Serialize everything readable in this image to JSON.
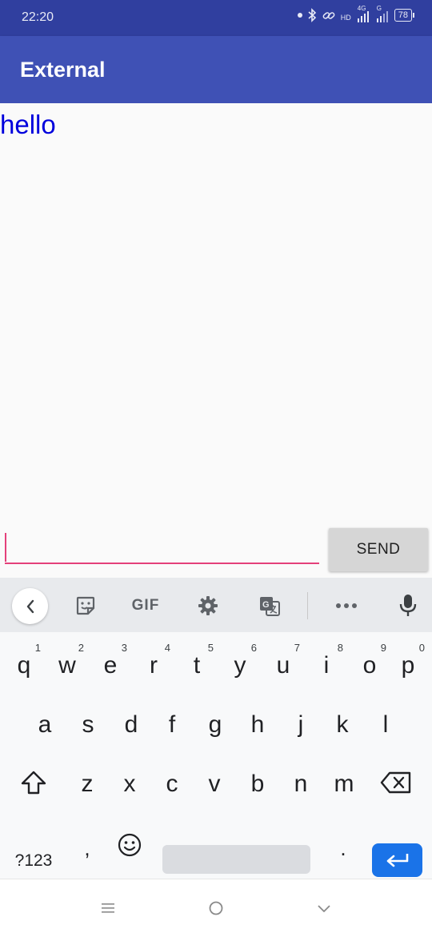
{
  "status_bar": {
    "time": "22:20",
    "network_hd": "HD",
    "network_4g": "4G",
    "network_g": "G",
    "battery": "78"
  },
  "app_bar": {
    "title": "External"
  },
  "content": {
    "message": "hello"
  },
  "composer": {
    "input_value": "",
    "send_label": "SEND"
  },
  "keyboard": {
    "gif_label": "GIF",
    "row1": [
      {
        "key": "q",
        "hint": "1"
      },
      {
        "key": "w",
        "hint": "2"
      },
      {
        "key": "e",
        "hint": "3"
      },
      {
        "key": "r",
        "hint": "4"
      },
      {
        "key": "t",
        "hint": "5"
      },
      {
        "key": "y",
        "hint": "6"
      },
      {
        "key": "u",
        "hint": "7"
      },
      {
        "key": "i",
        "hint": "8"
      },
      {
        "key": "o",
        "hint": "9"
      },
      {
        "key": "p",
        "hint": "0"
      }
    ],
    "row2": [
      "a",
      "s",
      "d",
      "f",
      "g",
      "h",
      "j",
      "k",
      "l"
    ],
    "row3": [
      "z",
      "x",
      "c",
      "v",
      "b",
      "n",
      "m"
    ],
    "symbols_label": "?123",
    "comma": ",",
    "period": "."
  },
  "colors": {
    "status_bar": "#303f9f",
    "app_bar": "#3f51b5",
    "message_text": "#0000dd",
    "input_underline": "#e4407a",
    "enter_key": "#1a73e8"
  }
}
